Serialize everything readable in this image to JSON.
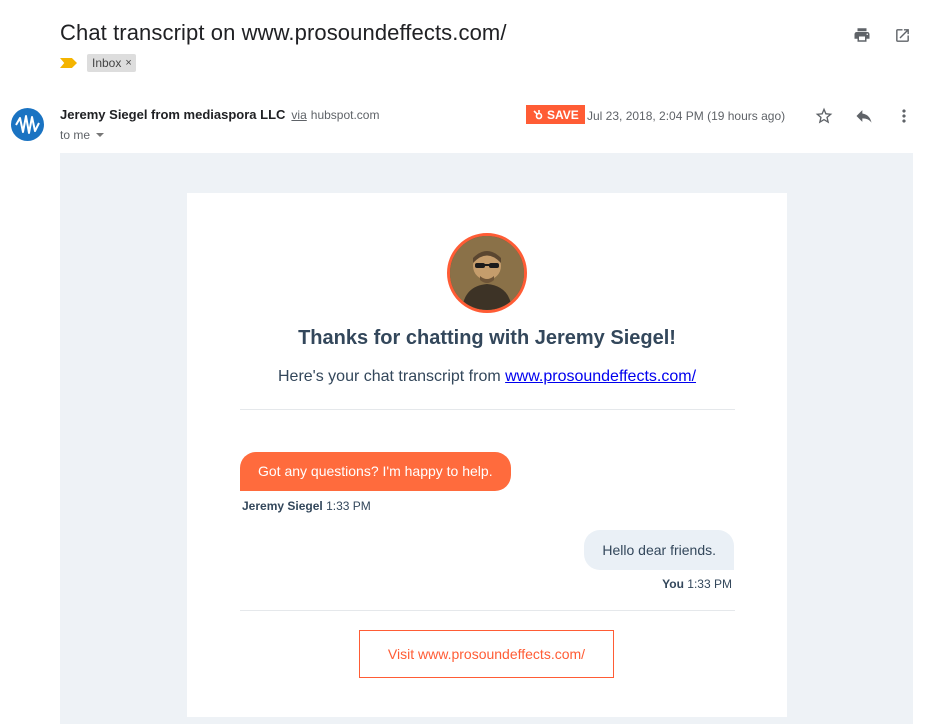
{
  "email": {
    "subject": "Chat transcript on www.prosoundeffects.com/",
    "label": "Inbox",
    "label_close": "×",
    "sender_name": "Jeremy Siegel from mediaspora LLC",
    "via": "via",
    "via_domain": "hubspot.com",
    "recipient": "to me",
    "save_label": "SAVE",
    "date": "Jul 23, 2018, 2:04 PM (19 hours ago)"
  },
  "card": {
    "title": "Thanks for chatting with Jeremy Siegel!",
    "subtitle_prefix": "Here's your chat transcript from ",
    "subtitle_link": "www.prosoundeffects.com/",
    "messages": [
      {
        "text": "Got any questions? I'm happy to help.",
        "author": "Jeremy Siegel",
        "time": "1:33 PM"
      },
      {
        "text": "Hello dear friends.",
        "author": "You",
        "time": "1:33 PM"
      }
    ],
    "cta_label": "Visit www.prosoundeffects.com/"
  },
  "colors": {
    "accent": "#ff5c35",
    "agent_bubble": "#ff6b3d",
    "user_bubble": "#eaf0f6",
    "background_panel": "#eef2f6",
    "heading": "#33475b",
    "importance": "#f4b400"
  },
  "icons": [
    "print-icon",
    "open-in-new-window-icon",
    "star-icon",
    "reply-icon",
    "more-vert-icon",
    "chevron-down-icon",
    "hubspot-sprocket-icon",
    "importance-marker-icon"
  ]
}
